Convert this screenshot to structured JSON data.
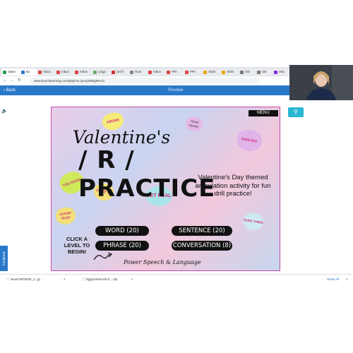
{
  "browser": {
    "tabs": [
      "Valen",
      "Bo",
      "Inbox",
      "Inbox",
      "Inbox",
      "Lingu",
      "(347)",
      "Hum",
      "Inbox",
      "##0",
      "##0",
      "2020",
      "2020",
      "OD",
      "OE",
      "eBu"
    ],
    "url": "www.boomlearning.com/play/Ho.QoAj33iMgRKn/1"
  },
  "appbar": {
    "back_label": "Back",
    "title": "Preview"
  },
  "slide": {
    "menu_label": "MENU",
    "title_line1": "Valentine's",
    "title_line2": "/ R / PRACTICE",
    "subtitle": "Valentine's Day themed articulation activity for fun drill practice!",
    "hearts": [
      "AMORE",
      "DEAR HEART",
      "DARLING",
      "YOU ROCK",
      "DARE YA",
      "GET REAL",
      "SUGAR RUSH",
      "SURE THING"
    ],
    "buttons": {
      "word": "WORD (20)",
      "sentence": "SENTENCE (20)",
      "phrase": "PHRASE (20)",
      "conversation": "CONVERSATION (8)"
    },
    "click_text": "CLICK A LEVEL TO BEGIN!",
    "brand": "Power Speech & Language"
  },
  "sidebar": {
    "feedback_label": "Feedback"
  },
  "downloads": {
    "items": [
      "wood-2879244_1...jp",
      "EggCartonArticS....zip"
    ],
    "show_all": "Show All"
  },
  "colors": {
    "accent": "#2a79c9",
    "slide_border": "#c64aa8",
    "search": "#2ab7d3"
  }
}
